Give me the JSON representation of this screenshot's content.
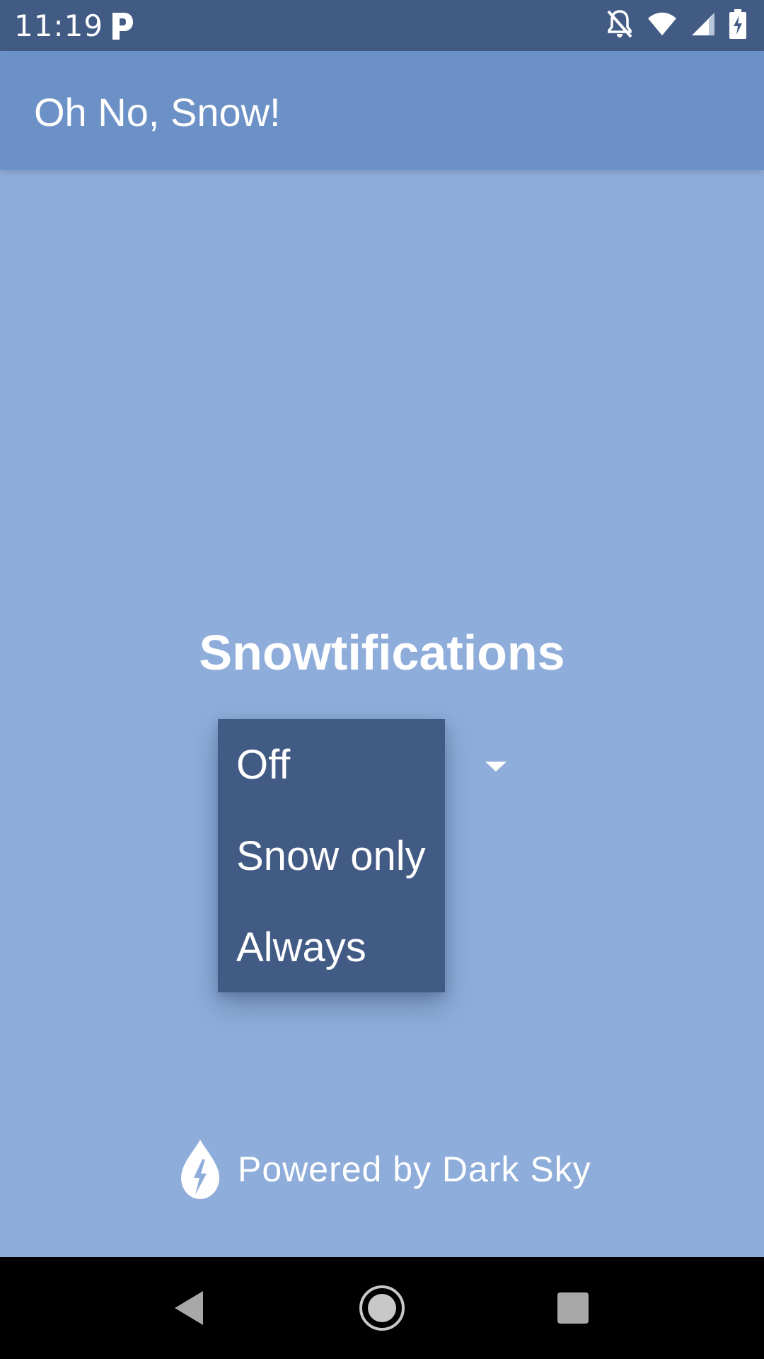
{
  "status_bar": {
    "time": "11:19",
    "app_icon": "parking-p-icon",
    "icons": [
      "notifications-off-icon",
      "wifi-icon",
      "cell-signal-icon",
      "battery-charging-icon"
    ]
  },
  "app_bar": {
    "title": "Oh No, Snow!"
  },
  "main": {
    "section_title": "Snowtifications",
    "dropdown": {
      "options": [
        "Off",
        "Snow only",
        "Always"
      ]
    }
  },
  "footer": {
    "powered_by": "Powered by Dark Sky",
    "logo_icon": "dark-sky-drop-icon"
  },
  "nav_bar": {
    "buttons": [
      "back-icon",
      "home-icon",
      "recents-icon"
    ]
  },
  "colors": {
    "status_bar": "#425b85",
    "app_bar": "#6c91c6",
    "background": "#8fadda",
    "menu": "#425b85",
    "text": "#ffffff"
  }
}
